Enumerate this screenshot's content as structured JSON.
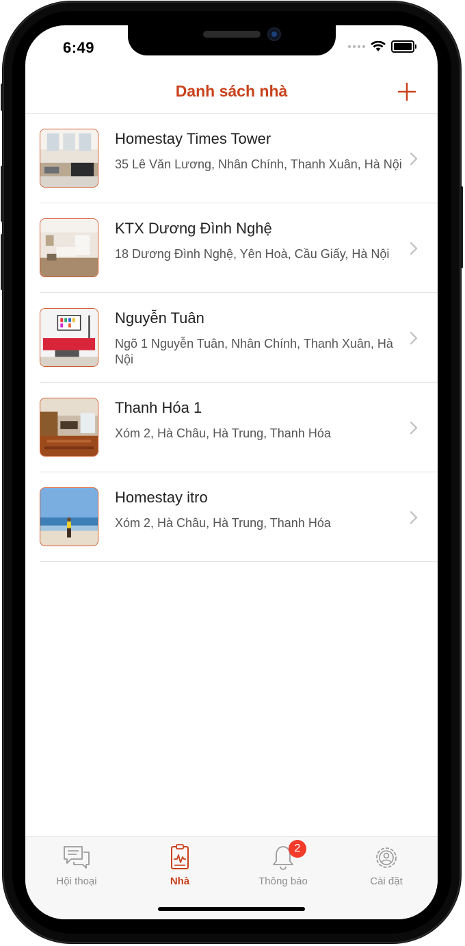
{
  "status_bar": {
    "time": "6:49"
  },
  "navbar": {
    "title": "Danh sách nhà",
    "add_icon": "plus-icon"
  },
  "colors": {
    "accent": "#c9421c",
    "badge": "#f23b2a",
    "inactive": "#8e8e8e"
  },
  "houses": [
    {
      "name": "Homestay Times Tower",
      "address": "35 Lê Văn Lương, Nhân Chính, Thanh Xuân, Hà Nội"
    },
    {
      "name": "KTX Dương Đình Nghệ",
      "address": "18 Dương Đình Nghệ, Yên Hoà, Cầu Giấy, Hà Nội"
    },
    {
      "name": "Nguyễn Tuân",
      "address": "Ngõ 1 Nguyễn Tuân, Nhân Chính, Thanh Xuân, Hà Nội"
    },
    {
      "name": "Thanh Hóa 1",
      "address": "Xóm 2, Hà Châu, Hà Trung, Thanh Hóa"
    },
    {
      "name": "Homestay itro",
      "address": "Xóm 2, Hà Châu, Hà Trung, Thanh Hóa"
    }
  ],
  "tabbar": {
    "tabs": [
      {
        "label": "Hội thoại",
        "icon": "chat-icon"
      },
      {
        "label": "Nhà",
        "icon": "clipboard-icon",
        "active": true
      },
      {
        "label": "Thông báo",
        "icon": "bell-icon",
        "badge": "2"
      },
      {
        "label": "Cài đặt",
        "icon": "gear-icon"
      }
    ]
  }
}
